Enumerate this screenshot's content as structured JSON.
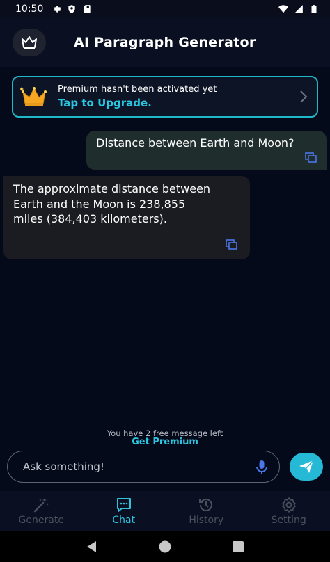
{
  "status_bar": {
    "time": "10:50"
  },
  "app_bar": {
    "title": "AI Paragraph Generator"
  },
  "premium_banner": {
    "line1": "Premium hasn't been activated yet",
    "line2": "Tap to Upgrade."
  },
  "chat": {
    "messages": [
      {
        "role": "user",
        "text": "Distance between Earth and Moon?"
      },
      {
        "role": "bot",
        "text": "The approximate distance between Earth and the Moon is 238,855 miles (384,403 kilometers)."
      }
    ]
  },
  "footer": {
    "free_note": "You have 2 free message left",
    "get_premium": "Get Premium"
  },
  "input": {
    "placeholder": "Ask something!"
  },
  "bottom_nav": {
    "items": [
      {
        "label": "Generate",
        "icon": "magic-wand-icon",
        "active": false
      },
      {
        "label": "Chat",
        "icon": "chat-icon",
        "active": true
      },
      {
        "label": "History",
        "icon": "history-icon",
        "active": false
      },
      {
        "label": "Setting",
        "icon": "gear-icon",
        "active": false
      }
    ]
  },
  "colors": {
    "accent": "#2ec3df",
    "banner_border": "#1fb8c9",
    "user_bubble": "#1f2e2c",
    "bot_bubble": "#1b1c21",
    "background": "#050a1a",
    "send_button": "#25b9d6"
  }
}
